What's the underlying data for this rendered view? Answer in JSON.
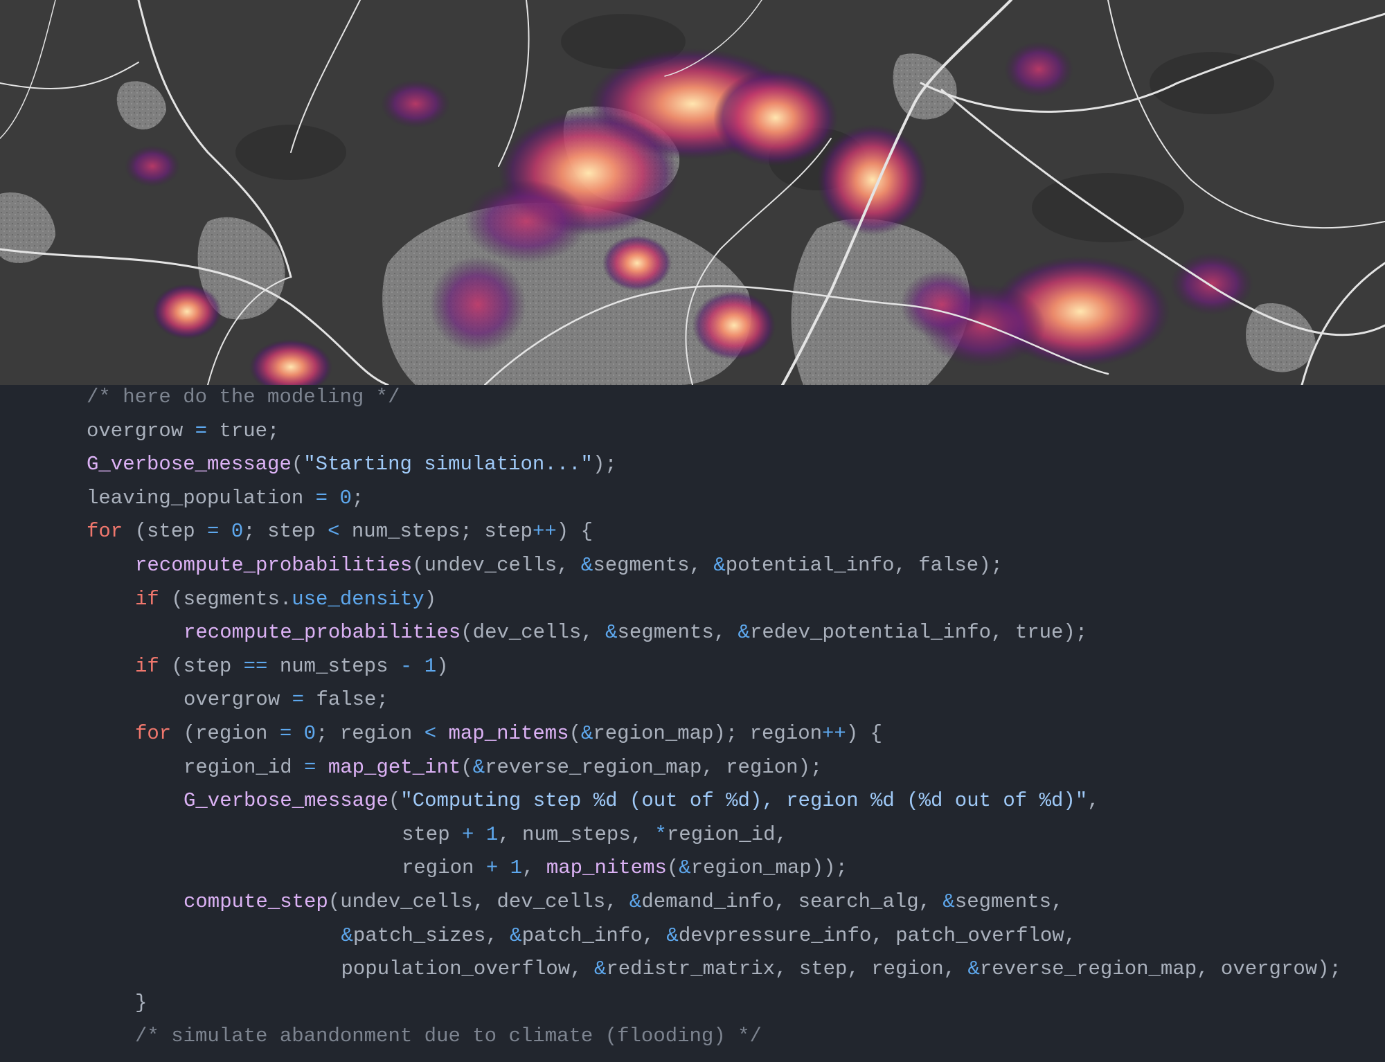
{
  "colors": {
    "code_background": "#22262e",
    "map_background": "#3b3b3b",
    "comment": "#7d8490",
    "keyword": "#f0776d",
    "function": "#dcb2f5",
    "string": "#9fc9f7",
    "operator": "#5ea8ee",
    "plain": "#aab1bd",
    "urban_gray": "#8a8a8a",
    "roads": "#e8e8e8",
    "hotspot_dark": "#5a1d6b",
    "hotspot_mid": "#d24a6a",
    "hotspot_bright": "#ffd79a"
  },
  "code": {
    "lines": [
      {
        "indent": 1,
        "tokens": [
          {
            "t": "comment",
            "v": "/* here do the modeling */"
          }
        ]
      },
      {
        "indent": 1,
        "tokens": [
          {
            "t": "plain",
            "v": "overgrow "
          },
          {
            "t": "op",
            "v": "="
          },
          {
            "t": "plain",
            "v": " true;"
          }
        ]
      },
      {
        "indent": 1,
        "tokens": [
          {
            "t": "func",
            "v": "G_verbose_message"
          },
          {
            "t": "plain",
            "v": "("
          },
          {
            "t": "string",
            "v": "\"Starting simulation...\""
          },
          {
            "t": "plain",
            "v": ");"
          }
        ]
      },
      {
        "indent": 1,
        "tokens": [
          {
            "t": "plain",
            "v": "leaving_population "
          },
          {
            "t": "op",
            "v": "="
          },
          {
            "t": "plain",
            "v": " "
          },
          {
            "t": "num",
            "v": "0"
          },
          {
            "t": "plain",
            "v": ";"
          }
        ]
      },
      {
        "indent": 1,
        "tokens": [
          {
            "t": "keyword",
            "v": "for"
          },
          {
            "t": "plain",
            "v": " (step "
          },
          {
            "t": "op",
            "v": "="
          },
          {
            "t": "plain",
            "v": " "
          },
          {
            "t": "num",
            "v": "0"
          },
          {
            "t": "plain",
            "v": "; step "
          },
          {
            "t": "op",
            "v": "<"
          },
          {
            "t": "plain",
            "v": " num_steps; step"
          },
          {
            "t": "op",
            "v": "++"
          },
          {
            "t": "plain",
            "v": ") {"
          }
        ]
      },
      {
        "indent": 2,
        "tokens": [
          {
            "t": "func",
            "v": "recompute_probabilities"
          },
          {
            "t": "plain",
            "v": "(undev_cells, "
          },
          {
            "t": "op",
            "v": "&"
          },
          {
            "t": "plain",
            "v": "segments, "
          },
          {
            "t": "op",
            "v": "&"
          },
          {
            "t": "plain",
            "v": "potential_info, false);"
          }
        ]
      },
      {
        "indent": 2,
        "tokens": [
          {
            "t": "keyword",
            "v": "if"
          },
          {
            "t": "plain",
            "v": " (segments."
          },
          {
            "t": "field",
            "v": "use_density"
          },
          {
            "t": "plain",
            "v": ")"
          }
        ]
      },
      {
        "indent": 3,
        "tokens": [
          {
            "t": "func",
            "v": "recompute_probabilities"
          },
          {
            "t": "plain",
            "v": "(dev_cells, "
          },
          {
            "t": "op",
            "v": "&"
          },
          {
            "t": "plain",
            "v": "segments, "
          },
          {
            "t": "op",
            "v": "&"
          },
          {
            "t": "plain",
            "v": "redev_potential_info, true);"
          }
        ]
      },
      {
        "indent": 2,
        "tokens": [
          {
            "t": "keyword",
            "v": "if"
          },
          {
            "t": "plain",
            "v": " (step "
          },
          {
            "t": "op",
            "v": "=="
          },
          {
            "t": "plain",
            "v": " num_steps "
          },
          {
            "t": "op",
            "v": "-"
          },
          {
            "t": "plain",
            "v": " "
          },
          {
            "t": "num",
            "v": "1"
          },
          {
            "t": "plain",
            "v": ")"
          }
        ]
      },
      {
        "indent": 3,
        "tokens": [
          {
            "t": "plain",
            "v": "overgrow "
          },
          {
            "t": "op",
            "v": "="
          },
          {
            "t": "plain",
            "v": " false;"
          }
        ]
      },
      {
        "indent": 2,
        "tokens": [
          {
            "t": "keyword",
            "v": "for"
          },
          {
            "t": "plain",
            "v": " (region "
          },
          {
            "t": "op",
            "v": "="
          },
          {
            "t": "plain",
            "v": " "
          },
          {
            "t": "num",
            "v": "0"
          },
          {
            "t": "plain",
            "v": "; region "
          },
          {
            "t": "op",
            "v": "<"
          },
          {
            "t": "plain",
            "v": " "
          },
          {
            "t": "func",
            "v": "map_nitems"
          },
          {
            "t": "plain",
            "v": "("
          },
          {
            "t": "op",
            "v": "&"
          },
          {
            "t": "plain",
            "v": "region_map); region"
          },
          {
            "t": "op",
            "v": "++"
          },
          {
            "t": "plain",
            "v": ") {"
          }
        ]
      },
      {
        "indent": 3,
        "tokens": [
          {
            "t": "plain",
            "v": "region_id "
          },
          {
            "t": "op",
            "v": "="
          },
          {
            "t": "plain",
            "v": " "
          },
          {
            "t": "func",
            "v": "map_get_int"
          },
          {
            "t": "plain",
            "v": "("
          },
          {
            "t": "op",
            "v": "&"
          },
          {
            "t": "plain",
            "v": "reverse_region_map, region);"
          }
        ]
      },
      {
        "indent": 3,
        "tokens": [
          {
            "t": "func",
            "v": "G_verbose_message"
          },
          {
            "t": "plain",
            "v": "("
          },
          {
            "t": "string",
            "v": "\"Computing step %d (out of %d), region %d (%d out of %d)\""
          },
          {
            "t": "plain",
            "v": ","
          }
        ]
      },
      {
        "indent": 7.5,
        "tokens": [
          {
            "t": "plain",
            "v": "step "
          },
          {
            "t": "op",
            "v": "+"
          },
          {
            "t": "plain",
            "v": " "
          },
          {
            "t": "num",
            "v": "1"
          },
          {
            "t": "plain",
            "v": ", num_steps, "
          },
          {
            "t": "op",
            "v": "*"
          },
          {
            "t": "plain",
            "v": "region_id,"
          }
        ]
      },
      {
        "indent": 7.5,
        "tokens": [
          {
            "t": "plain",
            "v": "region "
          },
          {
            "t": "op",
            "v": "+"
          },
          {
            "t": "plain",
            "v": " "
          },
          {
            "t": "num",
            "v": "1"
          },
          {
            "t": "plain",
            "v": ", "
          },
          {
            "t": "func",
            "v": "map_nitems"
          },
          {
            "t": "plain",
            "v": "("
          },
          {
            "t": "op",
            "v": "&"
          },
          {
            "t": "plain",
            "v": "region_map));"
          }
        ]
      },
      {
        "indent": 3,
        "tokens": [
          {
            "t": "func",
            "v": "compute_step"
          },
          {
            "t": "plain",
            "v": "(undev_cells, dev_cells, "
          },
          {
            "t": "op",
            "v": "&"
          },
          {
            "t": "plain",
            "v": "demand_info, search_alg, "
          },
          {
            "t": "op",
            "v": "&"
          },
          {
            "t": "plain",
            "v": "segments,"
          }
        ]
      },
      {
        "indent": 6.25,
        "tokens": [
          {
            "t": "op",
            "v": "&"
          },
          {
            "t": "plain",
            "v": "patch_sizes, "
          },
          {
            "t": "op",
            "v": "&"
          },
          {
            "t": "plain",
            "v": "patch_info, "
          },
          {
            "t": "op",
            "v": "&"
          },
          {
            "t": "plain",
            "v": "devpressure_info, patch_overflow,"
          }
        ]
      },
      {
        "indent": 6.25,
        "tokens": [
          {
            "t": "plain",
            "v": "population_overflow, "
          },
          {
            "t": "op",
            "v": "&"
          },
          {
            "t": "plain",
            "v": "redistr_matrix, step, region, "
          },
          {
            "t": "op",
            "v": "&"
          },
          {
            "t": "plain",
            "v": "reverse_region_map, overgrow);"
          }
        ]
      },
      {
        "indent": 2,
        "tokens": [
          {
            "t": "plain",
            "v": "}"
          }
        ]
      },
      {
        "indent": 2,
        "tokens": [
          {
            "t": "comment",
            "v": "/* simulate abandonment due to climate (flooding) */"
          }
        ]
      }
    ]
  }
}
